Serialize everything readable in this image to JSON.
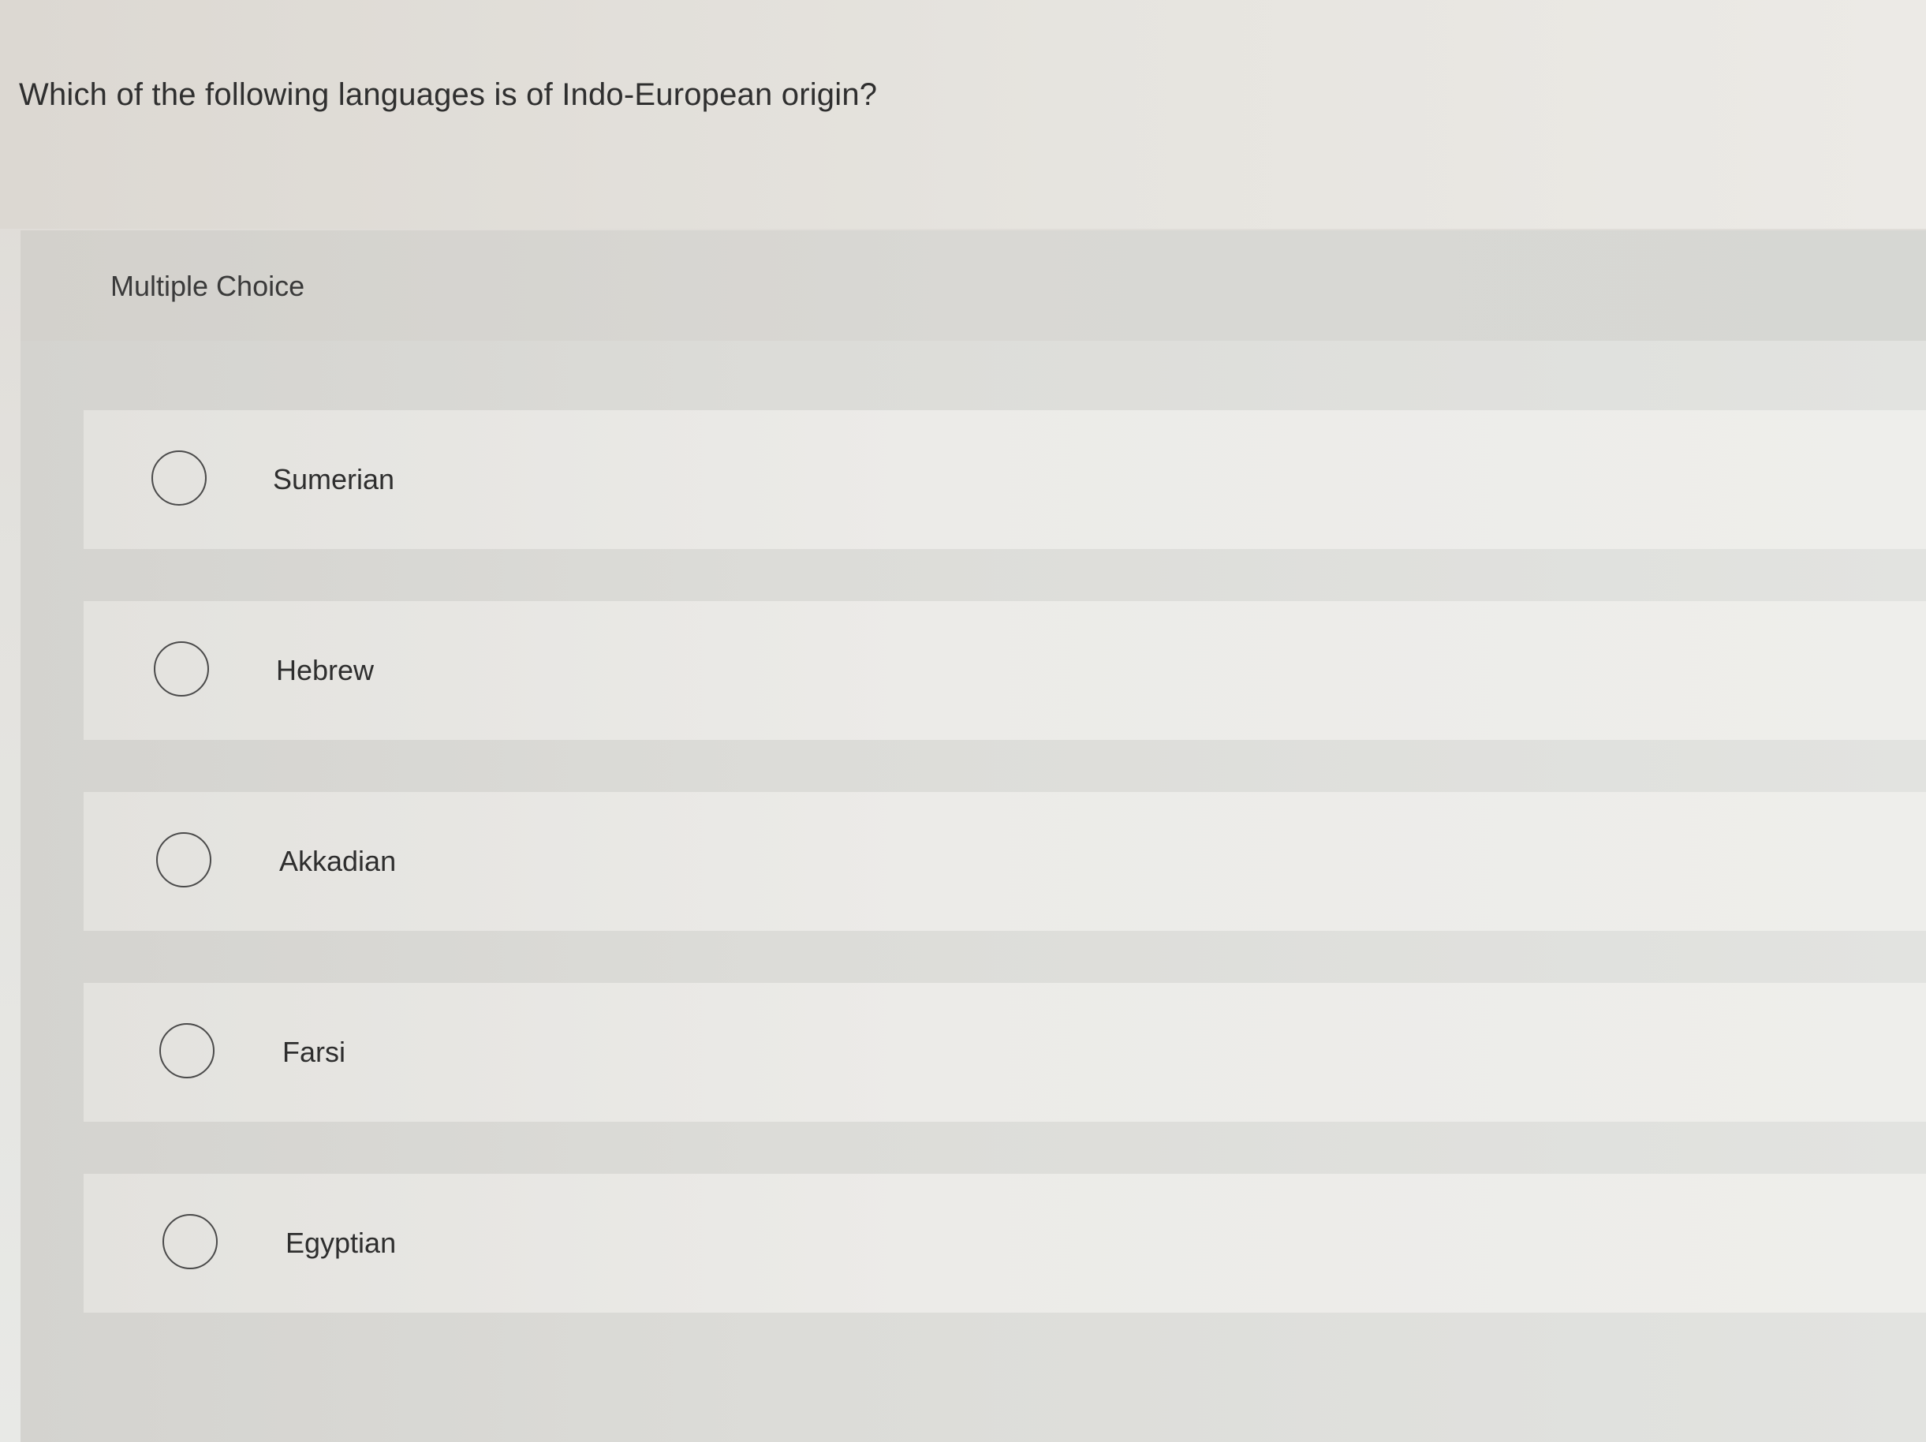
{
  "question": {
    "text": "Which of the following languages is of Indo-European origin?"
  },
  "multiple_choice": {
    "label": "Multiple Choice",
    "options": [
      {
        "label": "Sumerian",
        "selected": false
      },
      {
        "label": "Hebrew",
        "selected": false
      },
      {
        "label": "Akkadian",
        "selected": false
      },
      {
        "label": "Farsi",
        "selected": false
      },
      {
        "label": "Egyptian",
        "selected": false
      }
    ]
  }
}
